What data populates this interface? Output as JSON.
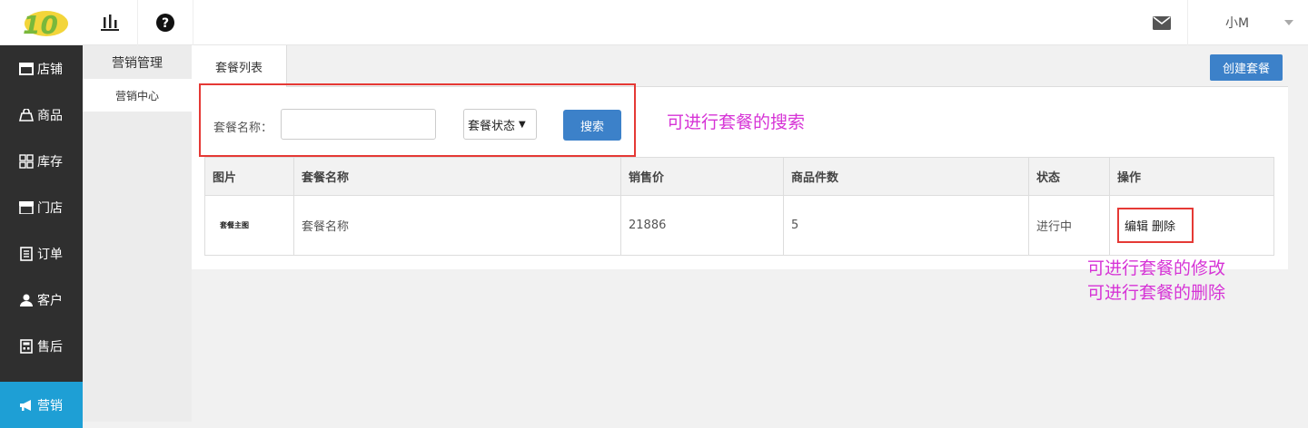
{
  "header": {
    "logo_text": "10",
    "user_name": "小M"
  },
  "sidebar": {
    "items": [
      {
        "label": "店铺",
        "icon": "store-icon"
      },
      {
        "label": "商品",
        "icon": "goods-icon"
      },
      {
        "label": "库存",
        "icon": "grid-icon"
      },
      {
        "label": "门店",
        "icon": "shop-icon"
      },
      {
        "label": "订单",
        "icon": "order-icon"
      },
      {
        "label": "客户",
        "icon": "customer-icon"
      },
      {
        "label": "售后",
        "icon": "aftersale-icon"
      },
      {
        "label": "营销",
        "icon": "megaphone-icon"
      }
    ]
  },
  "subnav": {
    "title": "营销管理",
    "item": "营销中心"
  },
  "tabs": {
    "active": "套餐列表"
  },
  "toolbar": {
    "create_label": "创建套餐"
  },
  "search": {
    "name_label": "套餐名称：",
    "name_value": "",
    "status_select": "套餐状态",
    "button_label": "搜索"
  },
  "table": {
    "headers": [
      "图片",
      "套餐名称",
      "销售价",
      "商品件数",
      "状态",
      "操作"
    ],
    "rows": [
      {
        "image_label": "套餐主图",
        "name": "套餐名称",
        "price": "21886",
        "count": "5",
        "status": "进行中",
        "edit": "编辑",
        "delete": "删除"
      }
    ]
  },
  "annotations": {
    "search_note": "可进行套餐的搜索",
    "edit_note_1": "可进行套餐的修改",
    "edit_note_2": "可进行套餐的删除"
  },
  "colors": {
    "sidebar_bg": "#2f2f2f",
    "active_blue": "#1e9fd5",
    "button_blue": "#3c81c9",
    "highlight_red": "#e53935",
    "note_magenta": "#d633d6"
  }
}
